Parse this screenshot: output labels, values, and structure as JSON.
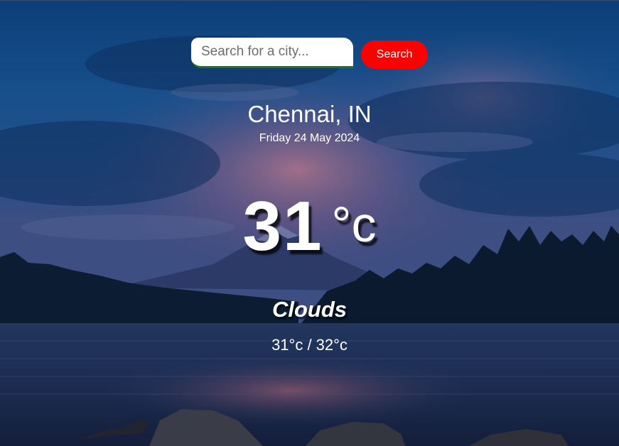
{
  "search": {
    "placeholder": "Search for a city...",
    "value": "",
    "button_label": "Search"
  },
  "weather": {
    "location": "Chennai, IN",
    "date": "Friday 24 May 2024",
    "temperature": "31",
    "unit": "°c",
    "condition": "Clouds",
    "hilo": "31°c / 32°c"
  },
  "colors": {
    "search_button": "#ff0000",
    "input_underline": "#1a7a1a",
    "text": "#ffffff"
  }
}
